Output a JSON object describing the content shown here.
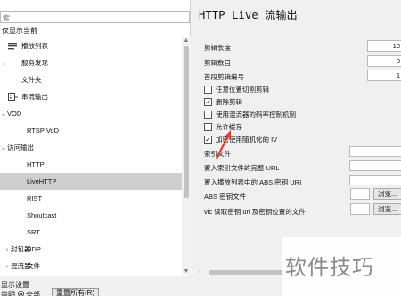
{
  "left_panel": {
    "search_placeholder": "索",
    "show_current_only": "仅显示当前",
    "tree": [
      {
        "label": "播放列表",
        "icon": "playlist-icon",
        "chev": ""
      },
      {
        "label": "服务发现",
        "icon": "",
        "chev": "›"
      },
      {
        "label": "文件夹",
        "icon": "",
        "chev": ""
      },
      {
        "label": "串流输出",
        "icon": "stream-output-icon",
        "chev": ""
      },
      {
        "label": "VOD",
        "icon": "",
        "chev": "⌄"
      },
      {
        "label": "RTSP VoD",
        "icon": "",
        "chev": ""
      },
      {
        "label": "访问输出",
        "icon": "",
        "chev": "⌄"
      },
      {
        "label": "HTTP",
        "icon": "",
        "chev": ""
      },
      {
        "label": "LiveHTTP",
        "icon": "",
        "chev": "",
        "selected": true
      },
      {
        "label": "RIST",
        "icon": "",
        "chev": ""
      },
      {
        "label": "Shoutcast",
        "icon": "",
        "chev": ""
      },
      {
        "label": "SRT",
        "icon": "",
        "chev": ""
      },
      {
        "label": "UDP",
        "icon": "",
        "chev": ""
      },
      {
        "label": "文件",
        "icon": "",
        "chev": ""
      },
      {
        "label": "封包器",
        "icon": "",
        "chev": "›"
      },
      {
        "label": "混流器",
        "icon": "",
        "chev": "›"
      }
    ],
    "show_settings": "显示设置",
    "radio_label": "简明",
    "radio_all": "全部",
    "reset_button": "重置所有(R)"
  },
  "right_panel": {
    "title": "HTTP Live 流输出",
    "segment_length_label": "剪辑长度",
    "segment_length_value": "10",
    "segment_count_label": "剪辑数目",
    "segment_count_value": "0",
    "first_segment_label": "首段剪辑编号",
    "first_segment_value": "1",
    "checkboxes": [
      {
        "label": "任意位置切割剪辑",
        "checked": false
      },
      {
        "label": "删除剪辑",
        "checked": true
      },
      {
        "label": "使用混流器的码率控制机制",
        "checked": false
      },
      {
        "label": "允许缓存",
        "checked": false
      },
      {
        "label": "加密使用随机化的 IV",
        "checked": true
      }
    ],
    "index_file_label": "索引文件",
    "index_url_label": "置入索引文件的完整 URL",
    "playlist_abs_label": "置入播放列表中的 ABS 密钥 URI",
    "abs_key_file_label": "ABS 密钥文件",
    "vlc_key_label": "vlc 读取密钥 uri 及密钥位置的文件",
    "browse_label": "浏览..."
  },
  "watermark": "软件技巧",
  "colors": {
    "selected_row": "#cfcfcf",
    "arrow": "#e53a2c",
    "panel_bg": "#f0f0f0"
  }
}
